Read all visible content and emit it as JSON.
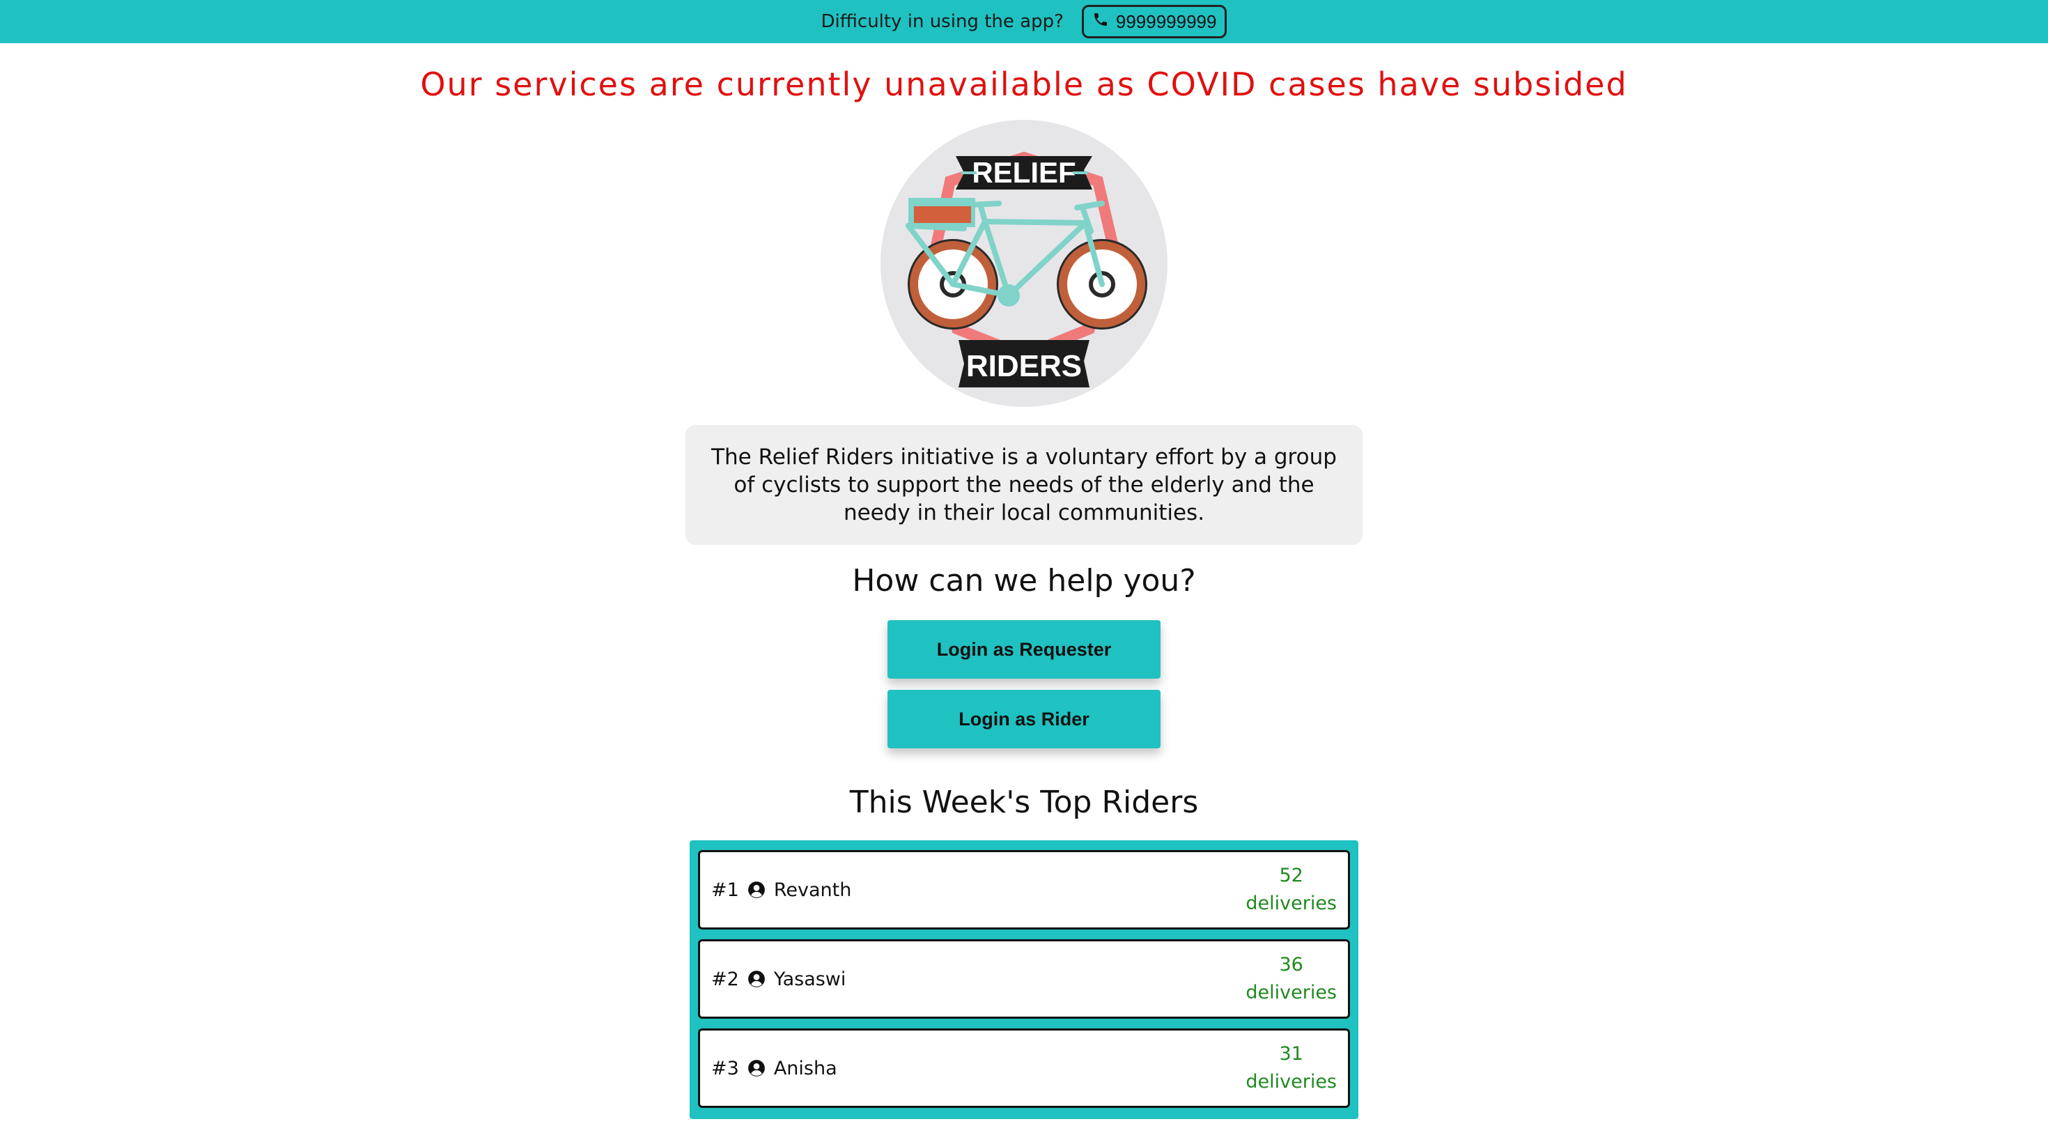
{
  "topbar": {
    "help_text": "Difficulty in using the app?",
    "phone_icon": "phone-icon",
    "phone_number": "9999999999"
  },
  "banner": {
    "text": "Our services are currently unavailable as COVID cases have subsided"
  },
  "logo": {
    "top_text": "RELIEF",
    "bottom_text": "RIDERS"
  },
  "about": {
    "text": "The Relief Riders initiative is a voluntary effort by a group of cyclists to support the needs of the elderly and the needy in their local communities."
  },
  "help": {
    "heading": "How can we help you?",
    "requester_label": "Login as Requester",
    "rider_label": "Login as Rider"
  },
  "top_riders": {
    "heading": "This Week's Top Riders",
    "user_icon": "user-circle-icon",
    "items": [
      {
        "rank": "#1",
        "name": "Revanth",
        "count": "52",
        "unit": "deliveries"
      },
      {
        "rank": "#2",
        "name": "Yasaswi",
        "count": "36",
        "unit": "deliveries"
      },
      {
        "rank": "#3",
        "name": "Anisha",
        "count": "31",
        "unit": "deliveries"
      }
    ]
  },
  "colors": {
    "accent": "#20c1c1",
    "alert": "#e01010",
    "deliveries": "#1f8a1f"
  }
}
